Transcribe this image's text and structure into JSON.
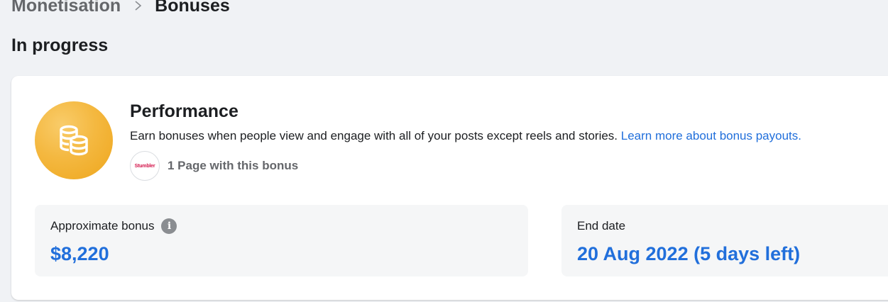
{
  "breadcrumb": {
    "parent": "Monetisation",
    "separator_icon": "chevron-right-icon",
    "current": "Bonuses"
  },
  "section": {
    "title": "In progress"
  },
  "card": {
    "icon": "coin-stack-icon",
    "title": "Performance",
    "description": "Earn bonuses when people view and engage with all of your posts except reels and stories.",
    "learn_more_link": "Learn more about bonus payouts.",
    "page_avatar_text": "Stumbler",
    "page_count_label": "1 Page with this bonus"
  },
  "stats": {
    "bonus": {
      "label": "Approximate bonus",
      "info_icon": "info-icon",
      "value": "$8,220"
    },
    "end_date": {
      "label": "End date",
      "value": "20 Aug 2022 (5 days left)"
    }
  },
  "colors": {
    "accent_blue": "#216fdb",
    "bonus_icon_gold": "#f4b840",
    "background": "#f0f2f5",
    "secondary_text": "#65676b"
  }
}
